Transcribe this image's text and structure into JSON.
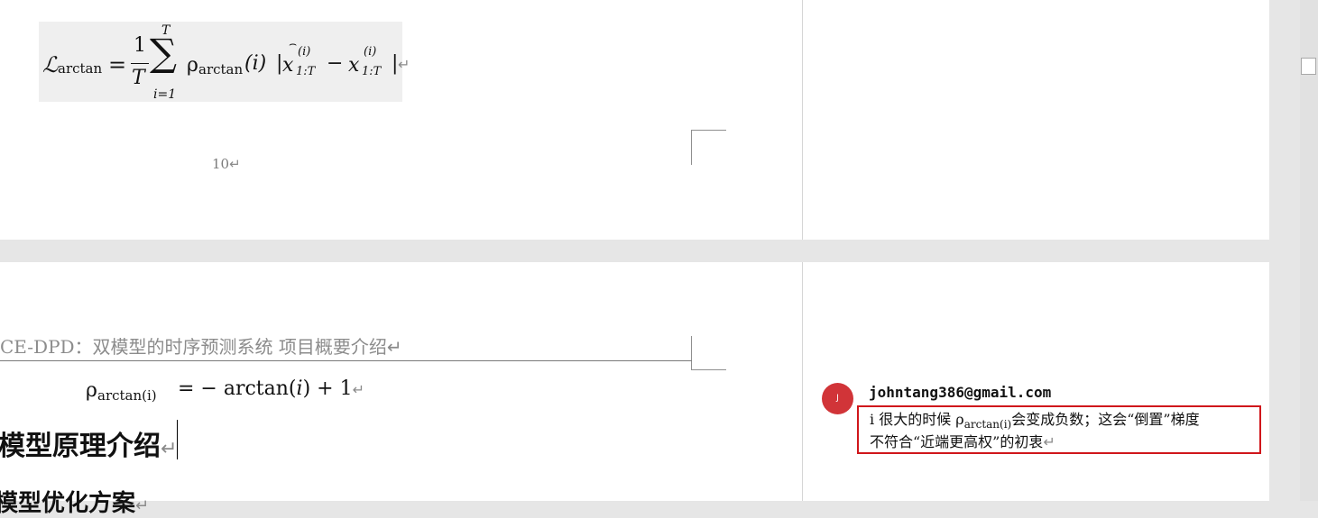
{
  "equation_loss": {
    "lhs": "ℒ",
    "lhs_sub": "arctan",
    "equals": "=",
    "frac_num": "1",
    "frac_den": "T",
    "sum_sym": "∑",
    "sum_top": "T",
    "sum_bottom": "i=1",
    "rho": "ρ",
    "rho_sub": "arctan",
    "arg": "(i)",
    "bar_open": "|",
    "x1": "x",
    "x1_sup": "(i)",
    "x1_sub": "1:T",
    "minus": "−",
    "x2": "x",
    "x2_sup": "(i)",
    "x2_sub": "1:T",
    "bar_close": "|",
    "para_mark": "↵"
  },
  "page_number": "10",
  "page_number_mark": "↵",
  "header": {
    "title": "CE-DPD：双模型的时序预测系统  项目概要介绍",
    "mark": "↵"
  },
  "equation_rho": {
    "rho": "ρ",
    "rho_sub": "arctan(i)",
    "rhs": "= − arctan(",
    "arg": "i",
    "rhs_end": ") + 1",
    "mark": "↵"
  },
  "heading_principle": {
    "text": "模型原理介绍",
    "mark": "↵"
  },
  "heading_optimization": {
    "text": "模型优化方案",
    "mark": "↵"
  },
  "comment": {
    "avatar_initial": "J",
    "author": "johntang386@gmail.com",
    "line1_prefix": "i 很大的时候 ",
    "rho": "ρ",
    "rho_sub": "arctan(i)",
    "line1_suffix": "会变成负数；这会“倒置”梯度",
    "line2": "不符合“近端更高权”的初衷",
    "mark": "↵"
  }
}
